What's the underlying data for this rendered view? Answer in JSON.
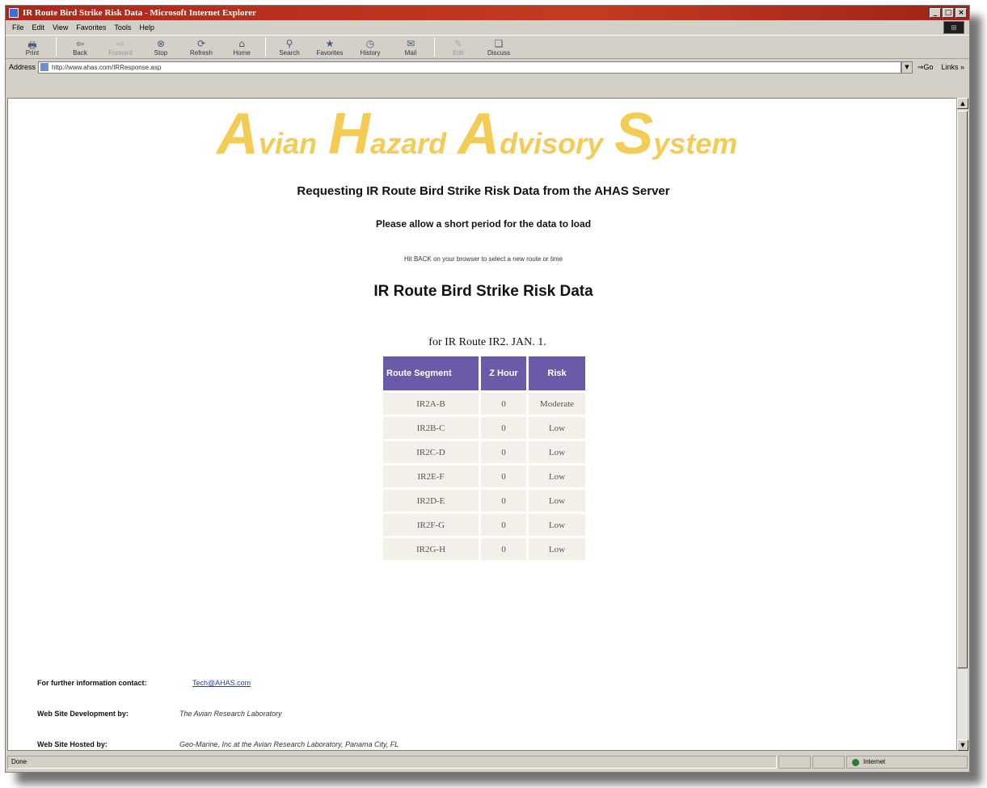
{
  "window": {
    "title": "IR Route Bird Strike Risk Data - Microsoft Internet Explorer",
    "controls": [
      "_",
      "□",
      "×"
    ]
  },
  "menu": [
    "File",
    "Edit",
    "View",
    "Favorites",
    "Tools",
    "Help"
  ],
  "toolbar": [
    {
      "label": "Print",
      "icon": "🖶",
      "disabled": false
    },
    {
      "label": "Back",
      "icon": "⇦",
      "disabled": false
    },
    {
      "label": "Forward",
      "icon": "⇨",
      "disabled": true
    },
    {
      "label": "Stop",
      "icon": "⊗",
      "disabled": false
    },
    {
      "label": "Refresh",
      "icon": "⟳",
      "disabled": false
    },
    {
      "label": "Home",
      "icon": "⌂",
      "disabled": false
    },
    {
      "label": "Search",
      "icon": "⚲",
      "disabled": false
    },
    {
      "label": "Favorites",
      "icon": "★",
      "disabled": false
    },
    {
      "label": "History",
      "icon": "◷",
      "disabled": false
    },
    {
      "label": "Mail",
      "icon": "✉",
      "disabled": false
    },
    {
      "label": "Edit",
      "icon": "✎",
      "disabled": true
    },
    {
      "label": "Discuss",
      "icon": "❏",
      "disabled": false
    }
  ],
  "address": {
    "label": "Address",
    "url": "http://www.ahas.com/IRResponse.asp",
    "go": "Go",
    "links": "Links"
  },
  "page": {
    "logo": [
      {
        "cap": "A",
        "rest": "vian"
      },
      {
        "cap": "H",
        "rest": "azard"
      },
      {
        "cap": "A",
        "rest": "dvisory"
      },
      {
        "cap": "S",
        "rest": "ystem"
      }
    ],
    "request_heading": "Requesting IR Route Bird Strike Risk Data from the AHAS Server",
    "wait_text": "Please allow a short period for the data to load",
    "back_text": "Hit BACK on your browser to select a new route or time",
    "data_heading": "IR Route Bird Strike Risk Data",
    "table_caption": "for IR Route IR2. JAN. 1.",
    "table": {
      "headers": [
        "Route Segment",
        "Z Hour",
        "Risk"
      ],
      "rows": [
        [
          "IR2A-B",
          "0",
          "Moderate"
        ],
        [
          "IR2B-C",
          "0",
          "Low"
        ],
        [
          "IR2C-D",
          "0",
          "Low"
        ],
        [
          "IR2E-F",
          "0",
          "Low"
        ],
        [
          "IR2D-E",
          "0",
          "Low"
        ],
        [
          "IR2F-G",
          "0",
          "Low"
        ],
        [
          "IR2G-H",
          "0",
          "Low"
        ]
      ],
      "header_color": "#6b5aa8",
      "row_color": "#f5efe9"
    },
    "footer": {
      "contact_label": "For further information contact:",
      "contact_email": "Tech@AHAS.com",
      "dev_label": "Web Site Development by:",
      "dev_value": "The Avian Research Laboratory",
      "host_label": "Web Site Hosted by:",
      "host_value": "Geo-Marine, Inc at the Avian Research Laboratory, Panama City, FL"
    }
  },
  "status": {
    "text": "Done",
    "zone": "Internet"
  },
  "colors": {
    "logo": "#f2cc55",
    "titlebar": "#b0251b"
  }
}
